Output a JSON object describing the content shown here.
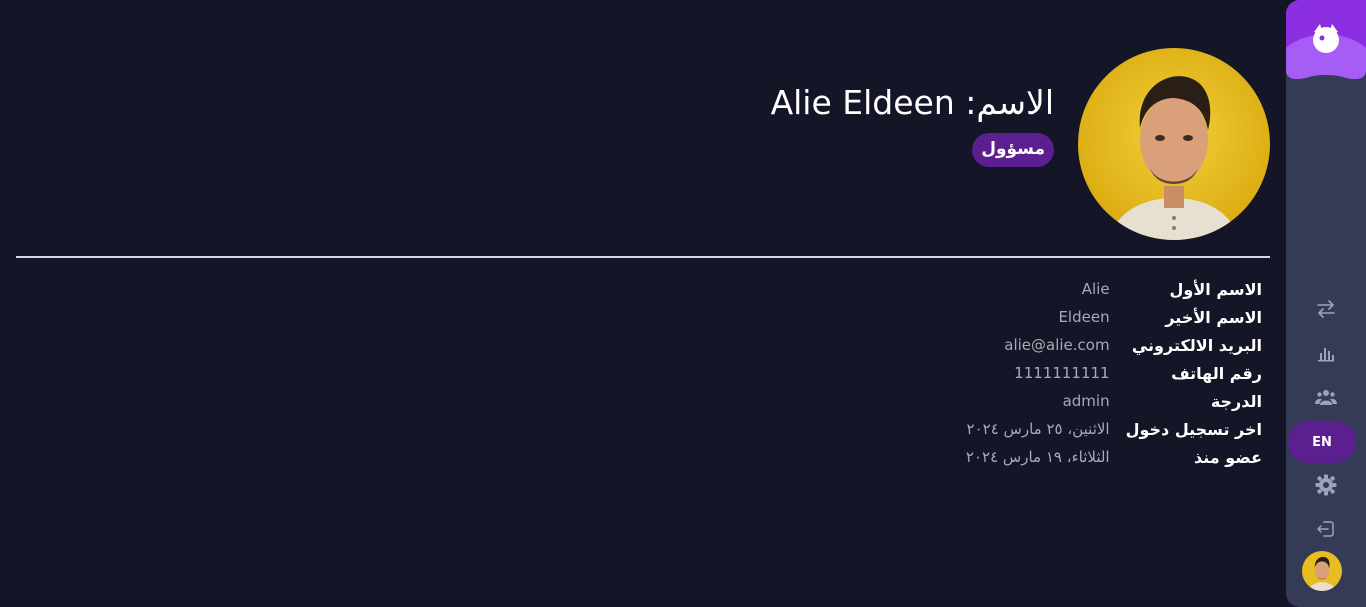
{
  "profile": {
    "name_label": "الاسم:",
    "name_value": "Alie Eldeen",
    "role_badge": "مسؤول"
  },
  "details": [
    {
      "label": "الاسم الأول",
      "value": "Alie"
    },
    {
      "label": "الاسم الأخير",
      "value": "Eldeen"
    },
    {
      "label": "البريد الالكتروني",
      "value": "alie@alie.com"
    },
    {
      "label": "رقم الهاتف",
      "value": "1111111111"
    },
    {
      "label": "الدرجة",
      "value": "admin"
    },
    {
      "label": "اخر تسجيل دخول",
      "value": "الاثنين، ٢٥ مارس ٢٠٢٤"
    },
    {
      "label": "عضو منذ",
      "value": "الثلاثاء، ١٩ مارس ٢٠٢٤"
    }
  ],
  "sidebar": {
    "icons": [
      "transfer-icon",
      "bar-chart-icon",
      "users-icon",
      "settings-icon",
      "logout-icon"
    ],
    "language_button": "EN"
  },
  "colors": {
    "background": "#141627",
    "sidebar": "#353a57",
    "accent": "#5b1f8f",
    "logo": "#a55df5"
  }
}
